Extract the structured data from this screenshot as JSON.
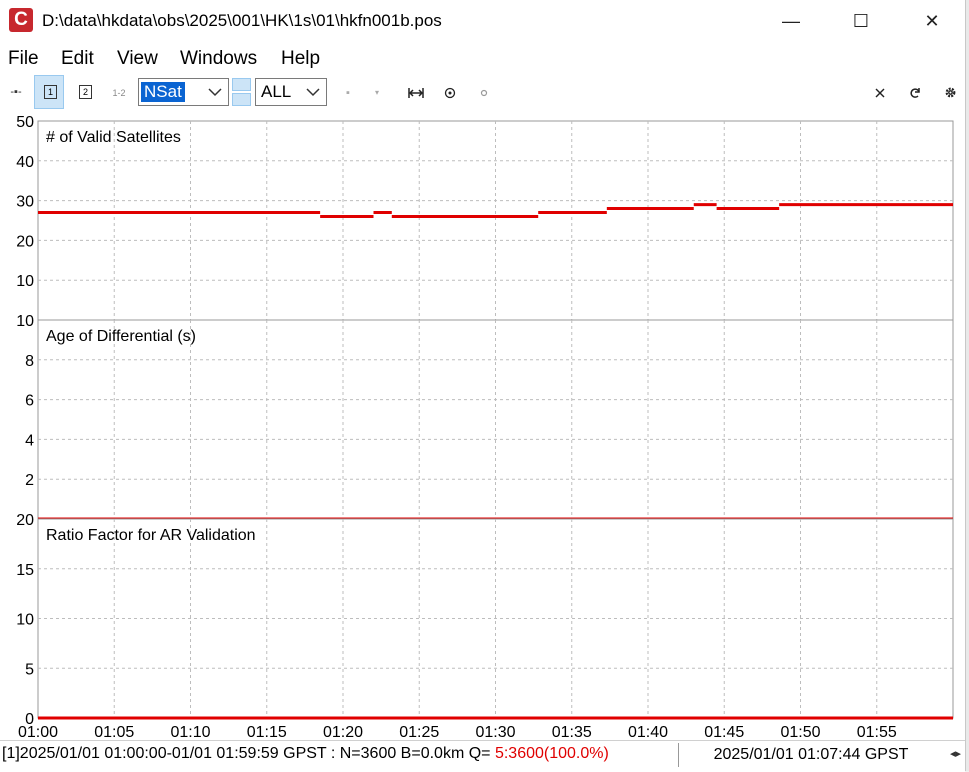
{
  "window": {
    "title": "D:\\data\\hkdata\\obs\\2025\\001\\HK\\1s\\01\\hkfn001b.pos",
    "app_icon_letter": "C",
    "minimize": "—",
    "maximize": "☐",
    "close": "✕"
  },
  "menu": [
    "File",
    "Edit",
    "View",
    "Windows",
    "Help"
  ],
  "toolbar": {
    "btn1": "1",
    "btn2": "2",
    "btn12": "1-2",
    "plot_type_select": "NSat",
    "sat_select": "ALL"
  },
  "chart_data": [
    {
      "type": "line",
      "title": "# of Valid Satellites",
      "ylim": [
        0,
        50
      ],
      "yticks": [
        10,
        20,
        30,
        40,
        50
      ],
      "grid": true,
      "color": "#e00000",
      "segments": [
        {
          "x0": 0,
          "x1": 18.5,
          "y": 27
        },
        {
          "x0": 18.5,
          "x1": 22.0,
          "y": 26
        },
        {
          "x0": 22.0,
          "x1": 23.2,
          "y": 27
        },
        {
          "x0": 23.2,
          "x1": 32.8,
          "y": 26
        },
        {
          "x0": 32.8,
          "x1": 37.3,
          "y": 27
        },
        {
          "x0": 37.3,
          "x1": 43.0,
          "y": 28
        },
        {
          "x0": 43.0,
          "x1": 44.5,
          "y": 29
        },
        {
          "x0": 44.5,
          "x1": 48.6,
          "y": 28
        },
        {
          "x0": 48.6,
          "x1": 60,
          "y": 29
        }
      ]
    },
    {
      "type": "line",
      "title": "Age of Differential (s)",
      "ylim": [
        0,
        10
      ],
      "yticks": [
        2,
        4,
        6,
        8,
        10
      ],
      "grid": true,
      "color": "#e00000",
      "segments": [
        {
          "x0": 0,
          "x1": 60,
          "y": 0
        }
      ]
    },
    {
      "type": "line",
      "title": "Ratio Factor for AR Validation",
      "ylim": [
        0,
        20
      ],
      "yticks": [
        0,
        5,
        10,
        15,
        20
      ],
      "grid": true,
      "color": "#e00000",
      "segments": [
        {
          "x0": 0,
          "x1": 60,
          "y": 0
        }
      ]
    }
  ],
  "x_axis": {
    "ticks": [
      "01:00",
      "01:05",
      "01:10",
      "01:15",
      "01:20",
      "01:25",
      "01:30",
      "01:35",
      "01:40",
      "01:45",
      "01:50",
      "01:55"
    ],
    "tick_minutes": [
      0,
      5,
      10,
      15,
      20,
      25,
      30,
      35,
      40,
      45,
      50,
      55
    ],
    "xlim_minutes": [
      0,
      60
    ]
  },
  "status": {
    "left_text": "[1]2025/01/01 01:00:00-01/01 01:59:59 GPST : N=3600 B=0.0km Q= ",
    "quality_text": "5:3600(100.0%)",
    "right_text": "2025/01/01 01:07:44 GPST",
    "arrow": "◂▸"
  }
}
